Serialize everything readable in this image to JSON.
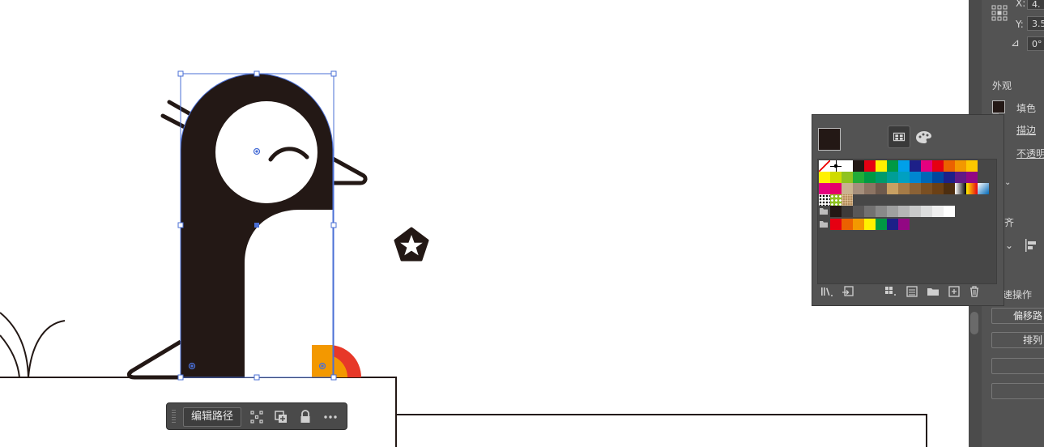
{
  "context_toolbar": {
    "edit_path_label": "编辑路径"
  },
  "properties": {
    "x_label": "X:",
    "x_value": "4.",
    "y_label": "Y:",
    "y_value": "3.5",
    "angle_value": "0°",
    "appearance_title": "外观",
    "fill_label": "填色",
    "stroke_label": "描边",
    "opacity_label": "不透明",
    "align_title_partial": "齐",
    "quick_actions_title": "速操作",
    "offset_path_label": "偏移路",
    "arrange_label": "排列"
  },
  "colors": {
    "fill": "#231815",
    "accent_selection": "#4a6fd6"
  },
  "swatches": {
    "row1": [
      "none",
      "registration",
      "#ffffff",
      "#231815",
      "#e60012",
      "#fff100",
      "#009944",
      "#00a0e9",
      "#1d2088",
      "#e4007f",
      "#e60012",
      "#eb6100",
      "#f39800",
      "#fcc800"
    ],
    "row2": [
      "#fff100",
      "#cfdb00",
      "#8fc31f",
      "#22ac38",
      "#009944",
      "#009b6b",
      "#009e96",
      "#00a0c1",
      "#0086d1",
      "#0068b7",
      "#00479d",
      "#1d2088",
      "#601986",
      "#920783"
    ],
    "row3": [
      "#e4007f",
      "#e5006a",
      "#c9b38f",
      "#a58f7c",
      "#8c7463",
      "#6e5a4d",
      "#c8a063",
      "#a57b47",
      "#8b6236",
      "#7a4f22",
      "#6b4015",
      "#4d2e10",
      "gradient_bw",
      "gradient_orange"
    ],
    "row3_extra": [
      "gradient_blue"
    ],
    "row4": [
      "pattern_dots",
      "pattern_leaf",
      "pattern_texture"
    ],
    "row5_group": [
      "#231815",
      "#3e3a39",
      "#595757",
      "#727171",
      "#898989",
      "#9fa0a0",
      "#b5b5b6",
      "#c9caca",
      "#dcdddd",
      "#efefef",
      "#ffffff"
    ],
    "row6_group": [
      "#e60012",
      "#eb6100",
      "#f39800",
      "#fff100",
      "#009944",
      "#1d2088",
      "#920783"
    ]
  },
  "icons": {
    "toolbar": [
      "grip-icon",
      "points-icon",
      "duplicate-icon",
      "lock-icon",
      "more-icon"
    ],
    "swatch_footer": [
      "library-icon",
      "place-icon",
      "show-kinds-icon",
      "swatch-options-icon",
      "new-group-icon",
      "new-swatch-icon",
      "delete-icon"
    ]
  }
}
